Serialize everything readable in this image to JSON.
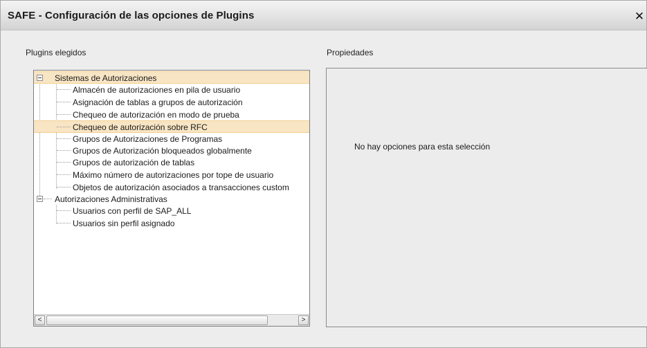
{
  "window": {
    "title": "SAFE - Configuración de las opciones de Plugins",
    "close_glyph": "✕"
  },
  "plugins_panel": {
    "label": "Plugins elegidos",
    "tree": [
      {
        "label": "Sistemas de Autorizaciones",
        "expanded": true,
        "selected": true,
        "children": [
          "Almacén de autorizaciones en pila de usuario",
          "Asignación de tablas a grupos de autorización",
          "Chequeo de autorización en modo de prueba",
          "Chequeo de autorización sobre RFC",
          "Grupos de Autorizaciones de Programas",
          "Grupos de Autorización bloqueados globalmente",
          "Grupos de autorización de tablas",
          "Máximo número de autorizaciones por tope de usuario",
          "Objetos de autorización asociados a transacciones custom"
        ]
      },
      {
        "label": "Autorizaciones Administrativas",
        "expanded": true,
        "selected": false,
        "children": [
          "Usuarios con perfil de SAP_ALL",
          "Usuarios sin perfil asignado"
        ]
      }
    ],
    "highlighted_child": "Chequeo de autorización sobre RFC",
    "scroll_left_glyph": "<",
    "scroll_right_glyph": ">",
    "colors": {
      "selection_fill": "#f8e5c4",
      "selection_border": "#f2cf8e"
    }
  },
  "properties_panel": {
    "label": "Propiedades",
    "empty_message": "No hay opciones para esta selección"
  }
}
